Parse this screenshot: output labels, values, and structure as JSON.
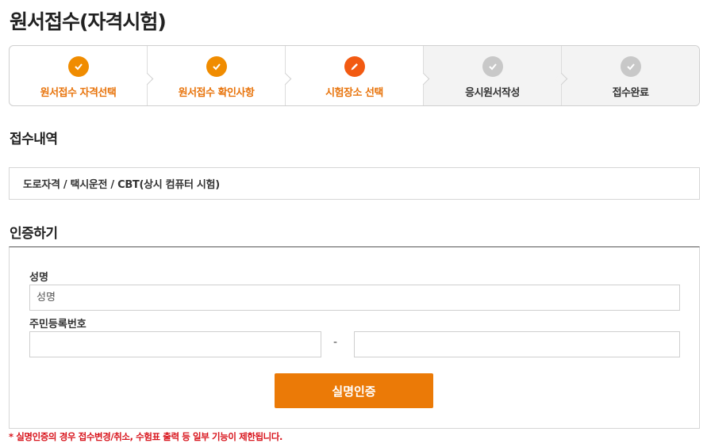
{
  "page": {
    "title": "원서접수(자격시험)"
  },
  "steps": [
    {
      "label": "원서접수 자격선택",
      "status": "done",
      "icon": "check-icon"
    },
    {
      "label": "원서접수 확인사항",
      "status": "done",
      "icon": "check-icon"
    },
    {
      "label": "시험장소 선택",
      "status": "active",
      "icon": "pencil-icon"
    },
    {
      "label": "응시원서작성",
      "status": "pending",
      "icon": "check-icon"
    },
    {
      "label": "접수완료",
      "status": "pending",
      "icon": "check-icon"
    }
  ],
  "receipt": {
    "title": "접수내역",
    "value": "도로자격 / 택시운전 / CBT(상시 컴퓨터 시험)"
  },
  "auth": {
    "title": "인증하기",
    "name_label": "성명",
    "name_placeholder": "성명",
    "rrn_label": "주민등록번호",
    "rrn_separator": "-",
    "verify_button": "실명인증"
  },
  "notice": "* 실명인증의 경우 접수변경/취소, 수험표 출력 등 일부 기능이 제한됩니다.",
  "colors": {
    "accent": "#eb7a07",
    "active_step": "#f25a12",
    "done_step": "#f08c00",
    "pending_step": "#c8c8c8",
    "notice": "#d8141c"
  }
}
